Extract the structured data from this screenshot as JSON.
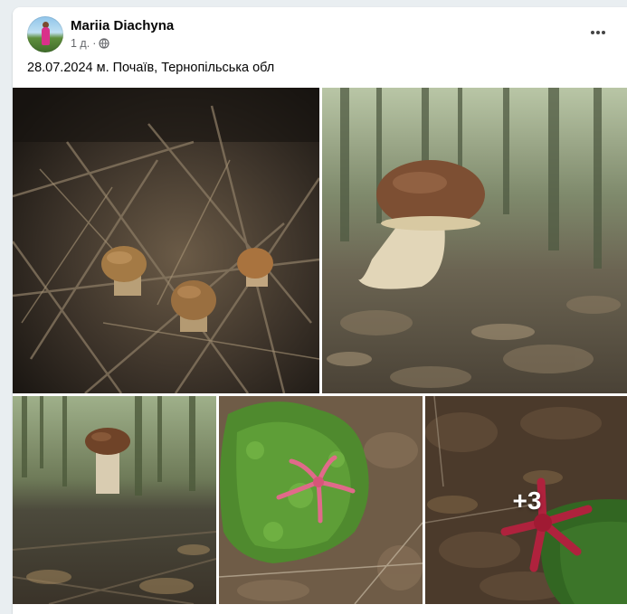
{
  "post": {
    "author": "Mariia Diachyna",
    "time": "1 д.",
    "separator": "·",
    "privacy_icon": "globe-icon",
    "text": "28.07.2024 м. Почаїв, Тернопільська обл",
    "more_options_icon": "more-horizontal-icon"
  },
  "photos": {
    "more_count": "+3",
    "items": [
      {
        "icon": "photo-mushrooms-in-twigs"
      },
      {
        "icon": "photo-large-porcini"
      },
      {
        "icon": "photo-porcini-in-forest"
      },
      {
        "icon": "photo-starfish-fungus-moss"
      },
      {
        "icon": "photo-red-starfish-fungus"
      }
    ]
  }
}
